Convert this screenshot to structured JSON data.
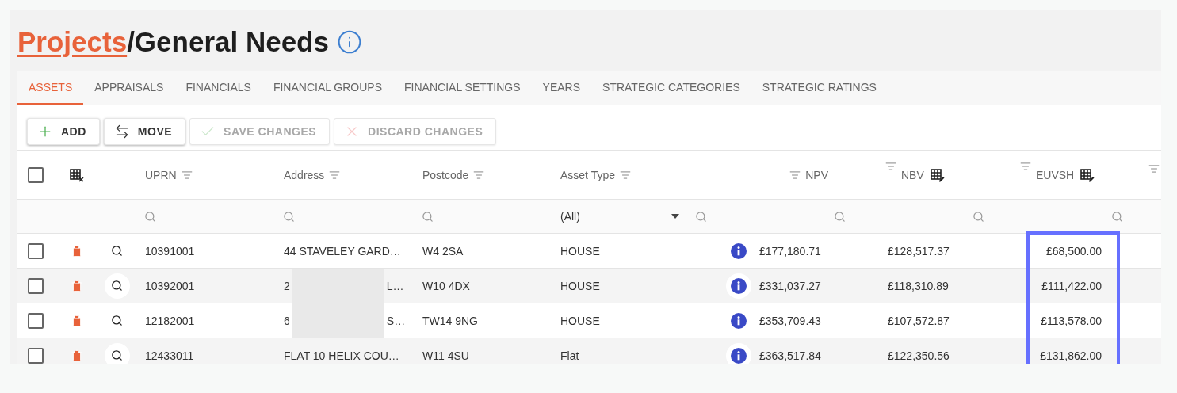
{
  "title": {
    "link": "Projects",
    "rest": "/General Needs"
  },
  "tabs": [
    {
      "label": "ASSETS",
      "selected": true
    },
    {
      "label": "APPRAISALS",
      "selected": false
    },
    {
      "label": "FINANCIALS",
      "selected": false
    },
    {
      "label": "FINANCIAL GROUPS",
      "selected": false
    },
    {
      "label": "FINANCIAL SETTINGS",
      "selected": false
    },
    {
      "label": "YEARS",
      "selected": false
    },
    {
      "label": "STRATEGIC CATEGORIES",
      "selected": false
    },
    {
      "label": "STRATEGIC RATINGS",
      "selected": false
    }
  ],
  "toolbar": [
    {
      "label": "ADD",
      "kind": "add",
      "disabled": false
    },
    {
      "label": "MOVE",
      "kind": "move",
      "disabled": false
    },
    {
      "label": "SAVE CHANGES",
      "kind": "save",
      "disabled": true
    },
    {
      "label": "DISCARD CHANGES",
      "kind": "discard",
      "disabled": true
    }
  ],
  "table": {
    "select_all": {
      "checked": false
    },
    "columns": [
      {
        "label": "UPRN",
        "kind": "text"
      },
      {
        "label": "Address",
        "kind": "text"
      },
      {
        "label": "Postcode",
        "kind": "text"
      },
      {
        "label": "Asset Type",
        "kind": "select",
        "filter_value": "(All)"
      },
      {
        "label": "NPV",
        "kind": "money"
      },
      {
        "label": "NBV",
        "kind": "editable"
      },
      {
        "label": "EUVSH",
        "kind": "editable",
        "highlighted": true
      }
    ],
    "rows": [
      {
        "checked": false,
        "uprn": "10391001",
        "address": {
          "start": "44 STAVELEY GARD…",
          "redacted": false
        },
        "postcode": "W4 2SA",
        "asset_type": "HOUSE",
        "npv": "£177,180.71",
        "nbv": "£128,517.37",
        "euvsh": "£68,500.00"
      },
      {
        "checked": false,
        "uprn": "10392001",
        "address": {
          "start": "2",
          "end": "L…",
          "redacted": true
        },
        "postcode": "W10 4DX",
        "asset_type": "HOUSE",
        "npv": "£331,037.27",
        "nbv": "£118,310.89",
        "euvsh": "£111,422.00"
      },
      {
        "checked": false,
        "uprn": "12182001",
        "address": {
          "start": "6",
          "end": "S…",
          "redacted": true
        },
        "postcode": "TW14 9NG",
        "asset_type": "HOUSE",
        "npv": "£353,709.43",
        "nbv": "£107,572.87",
        "euvsh": "£113,578.00"
      },
      {
        "checked": false,
        "uprn": "12433011",
        "address": {
          "start": "FLAT 10 HELIX COU…",
          "redacted": false
        },
        "postcode": "W11 4SU",
        "asset_type": "Flat",
        "npv": "£363,517.84",
        "nbv": "£122,350.56",
        "euvsh": "£131,862.00"
      }
    ]
  }
}
